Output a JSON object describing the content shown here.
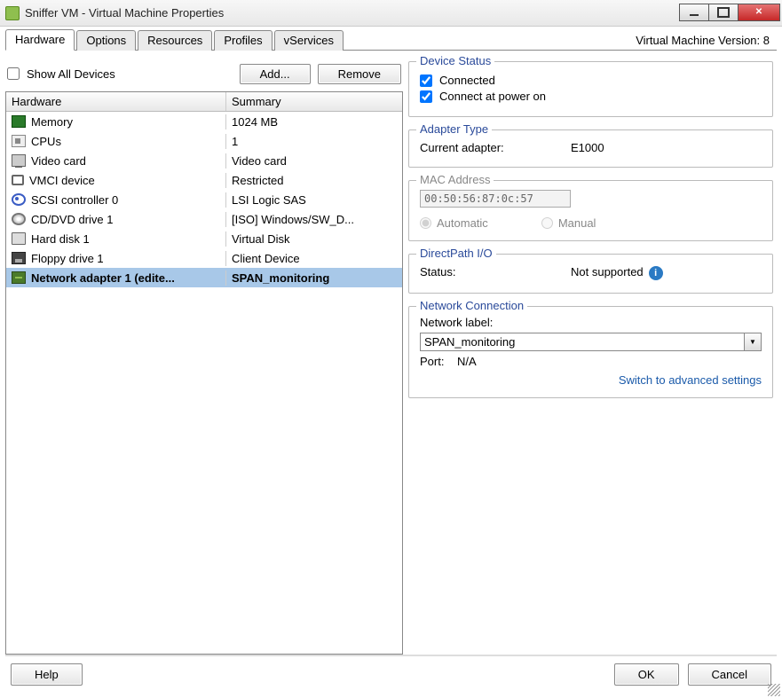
{
  "window": {
    "title": "Sniffer VM - Virtual Machine Properties",
    "version": "Virtual Machine Version: 8"
  },
  "tabs": [
    {
      "label": "Hardware",
      "active": true
    },
    {
      "label": "Options"
    },
    {
      "label": "Resources"
    },
    {
      "label": "Profiles"
    },
    {
      "label": "vServices"
    }
  ],
  "toolbar": {
    "show_all": "Show All Devices",
    "add": "Add...",
    "remove": "Remove"
  },
  "columns": {
    "hardware": "Hardware",
    "summary": "Summary"
  },
  "hardware_rows": [
    {
      "icon": "mem",
      "name": "Memory",
      "summary": "1024 MB"
    },
    {
      "icon": "cpu",
      "name": "CPUs",
      "summary": "1"
    },
    {
      "icon": "video",
      "name": "Video card",
      "summary": "Video card"
    },
    {
      "icon": "vmci",
      "name": "VMCI device",
      "summary": "Restricted"
    },
    {
      "icon": "scsi",
      "name": "SCSI controller 0",
      "summary": "LSI Logic SAS"
    },
    {
      "icon": "cd",
      "name": "CD/DVD drive 1",
      "summary": "[ISO] Windows/SW_D..."
    },
    {
      "icon": "hdd",
      "name": "Hard disk 1",
      "summary": "Virtual Disk"
    },
    {
      "icon": "floppy",
      "name": "Floppy drive 1",
      "summary": "Client Device"
    },
    {
      "icon": "net",
      "name": "Network adapter 1 (edite...",
      "summary": "SPAN_monitoring",
      "selected": true
    }
  ],
  "device_status": {
    "title": "Device Status",
    "connected": "Connected",
    "connect_at_power_on": "Connect at power on"
  },
  "adapter_type": {
    "title": "Adapter Type",
    "label": "Current adapter:",
    "value": "E1000"
  },
  "mac": {
    "title": "MAC Address",
    "value": "00:50:56:87:0c:57",
    "automatic": "Automatic",
    "manual": "Manual"
  },
  "directpath": {
    "title": "DirectPath I/O",
    "label": "Status:",
    "value": "Not supported"
  },
  "netconn": {
    "title": "Network Connection",
    "label": "Network label:",
    "value": "SPAN_monitoring",
    "port_label": "Port:",
    "port_value": "N/A",
    "switch_link": "Switch to advanced settings"
  },
  "footer": {
    "help": "Help",
    "ok": "OK",
    "cancel": "Cancel"
  }
}
